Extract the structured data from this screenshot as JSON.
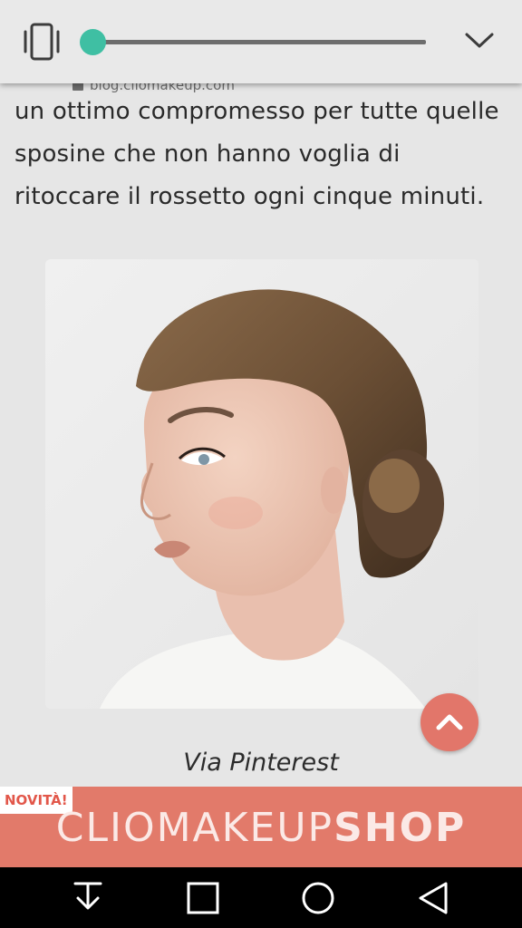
{
  "volume_panel": {
    "mode_icon": "vibrate-icon",
    "slider_level": 0,
    "accent_color": "#3fbfa3",
    "expand_icon": "chevron-down-icon"
  },
  "article": {
    "url": "blog.cliomakeup.com",
    "text_lines": [
      "un ottimo compromesso per tutte quelle",
      "sposine che non hanno voglia di",
      "ritoccare il rossetto ogni cinque minuti."
    ],
    "caption": "Via Pinterest",
    "scroll_top_icon": "chevron-up-icon",
    "scroll_top_color": "#e2766a"
  },
  "ad_banner": {
    "badge": "NOVITÀ!",
    "brand_regular": "CLIOMAKEUP",
    "brand_bold": "SHOP",
    "color": "#e27a6a"
  },
  "nav_bar": {
    "buttons": [
      "download-icon",
      "recents-icon",
      "home-icon",
      "back-icon"
    ]
  }
}
